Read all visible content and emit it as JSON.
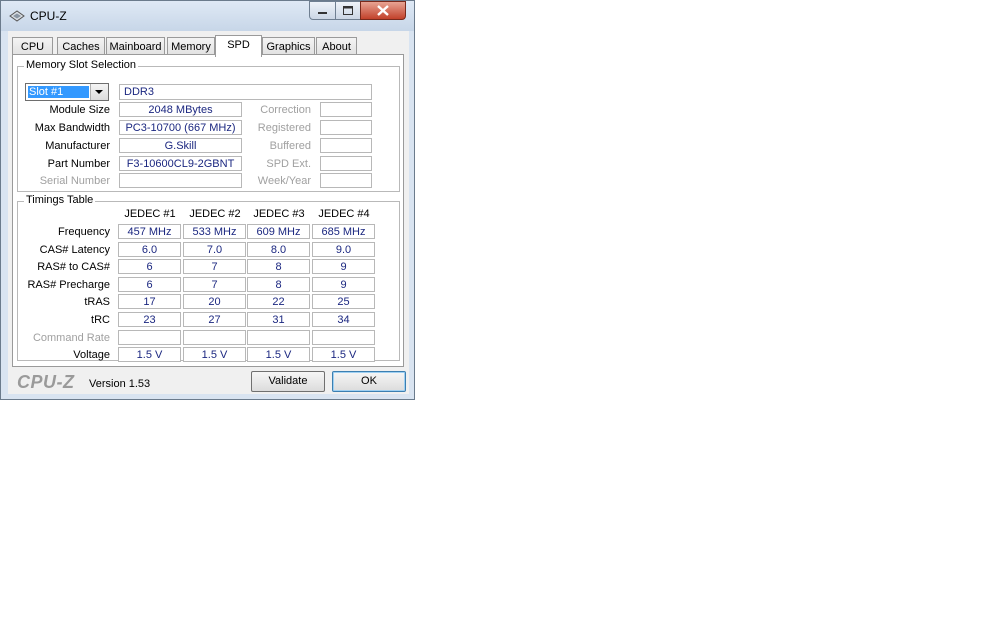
{
  "window": {
    "title": "CPU-Z"
  },
  "tabs": [
    "CPU",
    "Caches",
    "Mainboard",
    "Memory",
    "SPD",
    "Graphics",
    "About"
  ],
  "active_tab": "SPD",
  "slot_group": {
    "title": "Memory Slot Selection",
    "slot_value": "Slot #1",
    "memory_type": "DDR3",
    "rows": [
      {
        "label": "Module Size",
        "value": "2048 MBytes",
        "rlabel": "Correction",
        "rvalue": ""
      },
      {
        "label": "Max Bandwidth",
        "value": "PC3-10700 (667 MHz)",
        "rlabel": "Registered",
        "rvalue": ""
      },
      {
        "label": "Manufacturer",
        "value": "G.Skill",
        "rlabel": "Buffered",
        "rvalue": ""
      },
      {
        "label": "Part Number",
        "value": "F3-10600CL9-2GBNT",
        "rlabel": "SPD Ext.",
        "rvalue": ""
      },
      {
        "label": "Serial Number",
        "value": "",
        "rlabel": "Week/Year",
        "rvalue": ""
      }
    ]
  },
  "timings": {
    "title": "Timings Table",
    "columns": [
      "JEDEC #1",
      "JEDEC #2",
      "JEDEC #3",
      "JEDEC #4"
    ],
    "rows": [
      {
        "label": "Frequency",
        "values": [
          "457 MHz",
          "533 MHz",
          "609 MHz",
          "685 MHz"
        ]
      },
      {
        "label": "CAS# Latency",
        "values": [
          "6.0",
          "7.0",
          "8.0",
          "9.0"
        ]
      },
      {
        "label": "RAS# to CAS#",
        "values": [
          "6",
          "7",
          "8",
          "9"
        ]
      },
      {
        "label": "RAS# Precharge",
        "values": [
          "6",
          "7",
          "8",
          "9"
        ]
      },
      {
        "label": "tRAS",
        "values": [
          "17",
          "20",
          "22",
          "25"
        ]
      },
      {
        "label": "tRC",
        "values": [
          "23",
          "27",
          "31",
          "34"
        ]
      },
      {
        "label": "Command Rate",
        "values": [
          "",
          "",
          "",
          ""
        ]
      },
      {
        "label": "Voltage",
        "values": [
          "1.5 V",
          "1.5 V",
          "1.5 V",
          "1.5 V"
        ]
      }
    ]
  },
  "footer": {
    "brand": "CPU-Z",
    "version": "Version 1.53",
    "validate": "Validate",
    "ok": "OK"
  },
  "icons": {
    "app": "cpu-chip-icon",
    "dropdown": "chevron-down-icon"
  }
}
